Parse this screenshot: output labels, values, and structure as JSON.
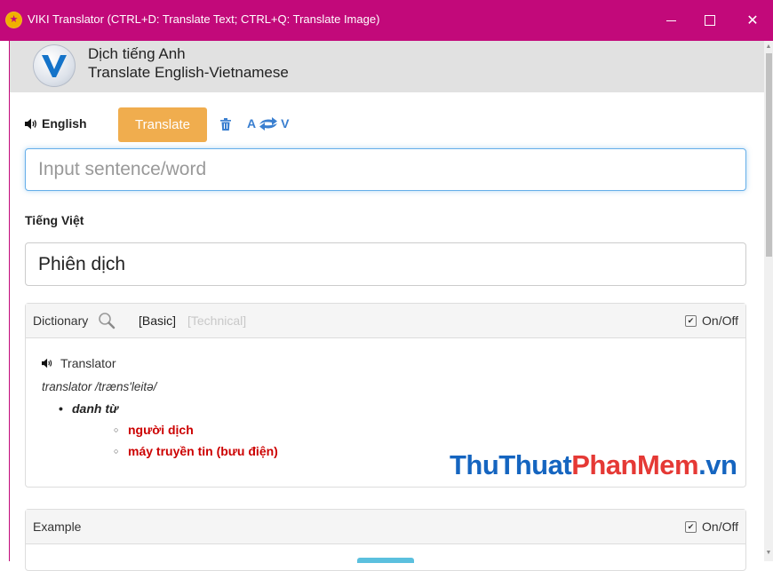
{
  "window": {
    "title": "VIKI Translator (CTRL+D: Translate Text; CTRL+Q: Translate Image)"
  },
  "header": {
    "line1": "Dịch tiếng Anh",
    "line2": "Translate English-Vietnamese"
  },
  "toolbar": {
    "source_lang": "English",
    "translate_label": "Translate",
    "swap_from": "A",
    "swap_to": "V"
  },
  "input": {
    "placeholder": "Input sentence/word",
    "value": ""
  },
  "target": {
    "lang_label": "Tiếng Việt",
    "output": "Phiên dịch"
  },
  "dictionary": {
    "label": "Dictionary",
    "mode_basic": "[Basic]",
    "mode_technical": "[Technical]",
    "toggle_label": "On/Off",
    "toggle_checked": true,
    "word": "Translator",
    "phonetic": "translator /træns'leitə/",
    "part_of_speech": "danh từ",
    "meanings": [
      "người dịch",
      "máy truyền tin (bưu điện)"
    ]
  },
  "example": {
    "label": "Example",
    "toggle_label": "On/Off",
    "toggle_checked": true
  },
  "watermark": {
    "part1": "ThuThuat",
    "part2": "PhanMem",
    "part3": ".vn"
  },
  "colors": {
    "titlebar": "#c2097a",
    "translate_button": "#f0ad4e",
    "meaning_text": "#cc0000",
    "accent_blue": "#3a7fd0"
  }
}
